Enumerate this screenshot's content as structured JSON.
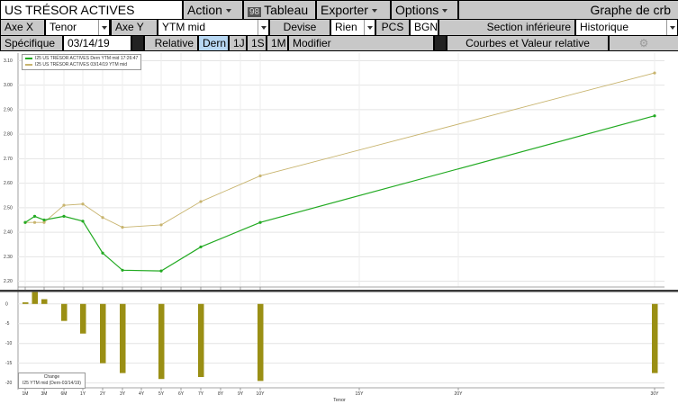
{
  "toolbar1": {
    "security": "US TRÉSOR ACTIVES",
    "action": "Action",
    "tableau_icon": "98",
    "tableau": "Tableau",
    "exporter": "Exporter",
    "options": "Options",
    "graph_title": "Graphe de crb"
  },
  "toolbar2": {
    "axe_x_label": "Axe X",
    "axe_x_value": "Tenor",
    "axe_y_label": "Axe Y",
    "axe_y_value": "YTM mid",
    "devise_label": "Devise",
    "devise_value": "Rien",
    "pcs_label": "PCS",
    "pcs_value": "BGN",
    "section_label": "Section inférieure",
    "section_value": "Historique"
  },
  "toolbar3": {
    "specific_label": "Spécifique",
    "date": "03/14/19",
    "relative_label": "Relative",
    "dern": "Dern",
    "p1j": "1J",
    "p1s": "1S",
    "p1m": "1M",
    "modifier": "Modifier",
    "curves_button": "Courbes et Valeur relative",
    "gear_icon": "gear-icon"
  },
  "legend": {
    "series1": "I25 US TRÉSOR ACTIVES Dern YTM mid 17:26:47",
    "series2": "I25 US TRÉSOR ACTIVES 03/14/19 YTM mid",
    "change_title": "Change",
    "change_desc": "I25 YTM mid (Dern-03/14/19)"
  },
  "colors": {
    "series1": "#22aa22",
    "series2": "#c8b46e",
    "change": "#9a8f14"
  },
  "chart_data": {
    "type": "line",
    "x_tenor_years": [
      0.0833,
      0.1667,
      0.25,
      0.5,
      1,
      2,
      3,
      5,
      7,
      10,
      30
    ],
    "series": [
      {
        "name": "I25 US TRÉSOR ACTIVES Dern YTM mid 17:26:47",
        "values": [
          2.44,
          2.465,
          2.45,
          2.465,
          2.445,
          2.315,
          2.245,
          2.242,
          2.34,
          2.44,
          2.875
        ]
      },
      {
        "name": "I25 US TRÉSOR ACTIVES 03/14/19 YTM mid",
        "values": [
          2.44,
          2.44,
          2.44,
          2.51,
          2.515,
          2.46,
          2.42,
          2.43,
          2.525,
          2.63,
          3.05
        ]
      }
    ],
    "ylim": [
      2.18,
      3.12
    ],
    "y_ticks": [
      "3.10",
      "3.00",
      "2.90",
      "2.80",
      "2.70",
      "2.60",
      "2.50",
      "2.40",
      "2.30",
      "2.20"
    ],
    "x_ticks_top": [
      "1M",
      "3M",
      "6M",
      "1Y",
      "2Y",
      "3Y",
      "4Y",
      "5Y",
      "6Y",
      "7Y",
      "8Y",
      "9Y",
      "10Y"
    ],
    "x_ticks": [
      "1M",
      "3M",
      "6M",
      "1Y",
      "2Y",
      "3Y",
      "4Y",
      "5Y",
      "6Y",
      "7Y",
      "8Y",
      "9Y",
      "10Y",
      "15Y",
      "20Y",
      "30Y"
    ],
    "xlabel": "Tenor",
    "change": {
      "type": "bar",
      "title": "Change",
      "values": [
        0.4,
        3.0,
        1.2,
        -4.3,
        -7.5,
        -15.0,
        -17.5,
        -19.0,
        -18.5,
        -19.5,
        -17.5
      ],
      "ylim": [
        -21,
        2
      ],
      "y_ticks": [
        "0",
        "-5",
        "-10",
        "-15",
        "-20"
      ]
    }
  }
}
